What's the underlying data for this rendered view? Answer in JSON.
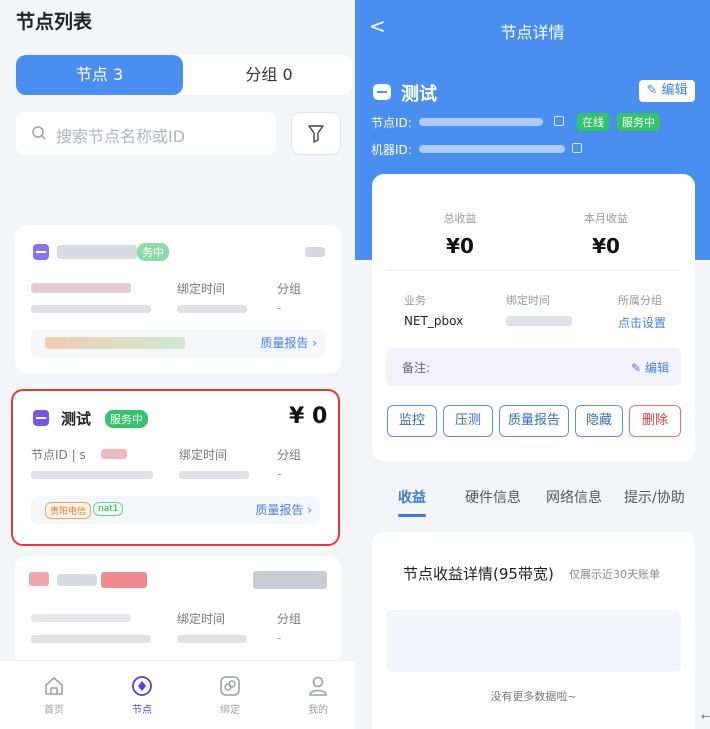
{
  "left": {
    "title": "节点列表",
    "tabs": [
      {
        "label": "节点 3"
      },
      {
        "label": "分组 0"
      }
    ],
    "search": {
      "placeholder": "搜索节点名称或ID"
    },
    "card1": {
      "status": "务中",
      "bind_time_label": "绑定时间",
      "group_label": "分组",
      "group_value": "-",
      "quality_link": "质量报告 ›"
    },
    "card2": {
      "name": "测试",
      "status": "服务中",
      "price": "¥ 0",
      "node_id_label": "节点ID | s",
      "bind_time_label": "绑定时间",
      "group_label": "分组",
      "group_value": "-",
      "tags": [
        "贵阳电信",
        "nat1"
      ],
      "quality_link": "质量报告 ›"
    },
    "card3": {
      "bind_time_label": "绑定时间",
      "group_label": "分组",
      "group_value": "-"
    },
    "nav": [
      {
        "label": "首页",
        "icon": "home-icon"
      },
      {
        "label": "节点",
        "icon": "node-icon"
      },
      {
        "label": "绑定",
        "icon": "bind-icon"
      },
      {
        "label": "我的",
        "icon": "user-icon"
      }
    ]
  },
  "right": {
    "title": "节点详情",
    "back": "<",
    "name": "测试",
    "edit": "✎ 编辑",
    "node_id_label": "节点ID:",
    "machine_id_label": "机器ID:",
    "badges": [
      "在线",
      "服务中"
    ],
    "stats": [
      {
        "label": "总收益",
        "value": "¥0"
      },
      {
        "label": "本月收益",
        "value": "¥0"
      }
    ],
    "info": {
      "business_label": "业务",
      "business_value": "NET_pbox",
      "bind_time_label": "绑定时间",
      "group_label": "所属分组",
      "group_link": "点击设置"
    },
    "note": {
      "label": "备注:",
      "edit": "✎ 编辑"
    },
    "actions": [
      "监控",
      "压测",
      "质量报告",
      "隐藏",
      "删除"
    ],
    "tabs": [
      "收益",
      "硬件信息",
      "网络信息",
      "提示/协助"
    ],
    "income": {
      "title": "节点收益详情(95带宽)",
      "subtitle": "仅展示近30天账单",
      "empty": "没有更多数据啦~"
    }
  },
  "corner": "←"
}
